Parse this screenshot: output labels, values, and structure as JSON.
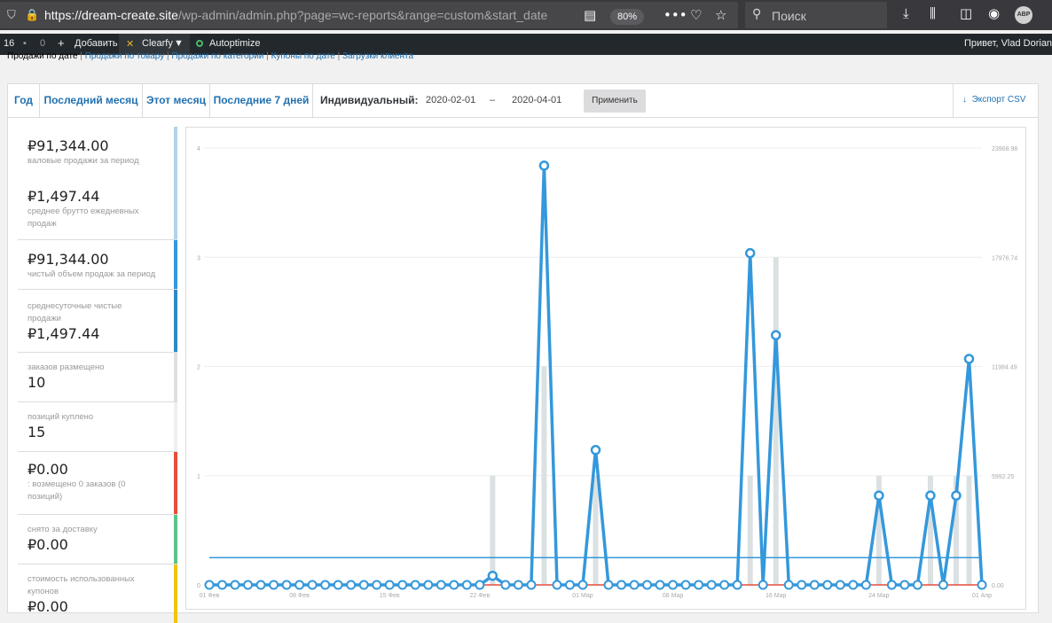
{
  "browser": {
    "url_main": "https://dream-create.site",
    "url_path": "/wp-admin/admin.php?page=wc-reports&range=custom&start_date",
    "zoom": "80%",
    "search_placeholder": "Поиск",
    "avatar": "ABP"
  },
  "adminbar": {
    "updates": "16",
    "comments": "0",
    "add_new": "Добавить",
    "clearfy": "Clearfy",
    "autoptimize": "Autoptimize",
    "greeting": "Привет, Vlad Dorian"
  },
  "subnav": [
    "Продажи по дате",
    "Продажи по товару",
    "Продажи по категории",
    "Купоны по дате",
    "Загрузки клиента"
  ],
  "tabs": {
    "year": "Год",
    "last_month": "Последний месяц",
    "this_month": "Этот месяц",
    "last7": "Последние 7 дней",
    "custom": "Индивидуальный:",
    "start_date": "2020-02-01",
    "dash": "–",
    "end_date": "2020-04-01",
    "apply": "Применить",
    "export": "Экспорт CSV"
  },
  "legend": {
    "gross": {
      "amount": "₽91,344.00",
      "label": "валовые продажи за период"
    },
    "avg_gross": {
      "amount": "₽1,497.44",
      "label": "среднее брутто ежедневных продаж"
    },
    "net": {
      "amount": "₽91,344.00",
      "label": "чистый объем продаж за период"
    },
    "avg_net": {
      "label": "среднесуточные чистые продажи",
      "amount": "₽1,497.44"
    },
    "orders": {
      "label": "заказов размещено",
      "amount": "10"
    },
    "items": {
      "label": "позиций куплено",
      "amount": "15"
    },
    "refunds": {
      "amount": "₽0.00",
      "label": ": возмещено 0 заказов (0 позиций)"
    },
    "shipping": {
      "label": "снято за доставку",
      "amount": "₽0.00"
    },
    "coupons": {
      "label": "стоимость использованных купонов",
      "amount": "₽0.00"
    }
  },
  "colors": {
    "blue": "#3498db",
    "gray_bar": "#dbe1e3",
    "red": "#e74c3c",
    "light_blue": "#b1d4ea",
    "dark_blue": "#2e8ac5",
    "green": "#5cc488",
    "yellow": "#f1c40f",
    "legend_light": "#ecf0f1"
  },
  "chart_data": {
    "type": "line",
    "x_tick_labels": [
      "01 Фев",
      "08 Фев",
      "15 Фев",
      "22 Фев",
      "01 Мар",
      "08 Мар",
      "16 Мар",
      "24 Мар",
      "01 Апр"
    ],
    "y_left_ticks": [
      "0",
      "1",
      "2",
      "3",
      "4"
    ],
    "y_right_ticks": [
      "0.00",
      "5992.25",
      "11984.49",
      "17976.74",
      "23968.98"
    ],
    "days": 61,
    "series": [
      {
        "role": "sales",
        "values": [
          0,
          0,
          0,
          0,
          0,
          0,
          0,
          0,
          0,
          0,
          0,
          0,
          0,
          0,
          0,
          0,
          0,
          0,
          0,
          0,
          0,
          0,
          500,
          0,
          0,
          0,
          23000,
          0,
          0,
          0,
          7400,
          0,
          0,
          0,
          0,
          0,
          0,
          0,
          0,
          0,
          0,
          0,
          18200,
          0,
          13700,
          0,
          0,
          0,
          0,
          0,
          0,
          0,
          4900,
          0,
          0,
          0,
          4900,
          0,
          4900,
          12400,
          0
        ]
      },
      {
        "role": "orders",
        "values": [
          0,
          0,
          0,
          0,
          0,
          0,
          0,
          0,
          0,
          0,
          0,
          0,
          0,
          0,
          0,
          0,
          0,
          0,
          0,
          0,
          0,
          0,
          1,
          0,
          0,
          0,
          2,
          0,
          0,
          0,
          1,
          0,
          0,
          0,
          0,
          0,
          0,
          0,
          0,
          0,
          0,
          0,
          1,
          0,
          3,
          0,
          0,
          0,
          0,
          0,
          0,
          0,
          1,
          0,
          0,
          0,
          1,
          0,
          1,
          1,
          0
        ]
      },
      {
        "role": "average",
        "values": [
          1497.44
        ]
      },
      {
        "role": "refunds",
        "values": [
          0
        ]
      }
    ],
    "ylim_left": [
      0,
      4
    ],
    "ylim_right": [
      0,
      23968.98
    ]
  }
}
